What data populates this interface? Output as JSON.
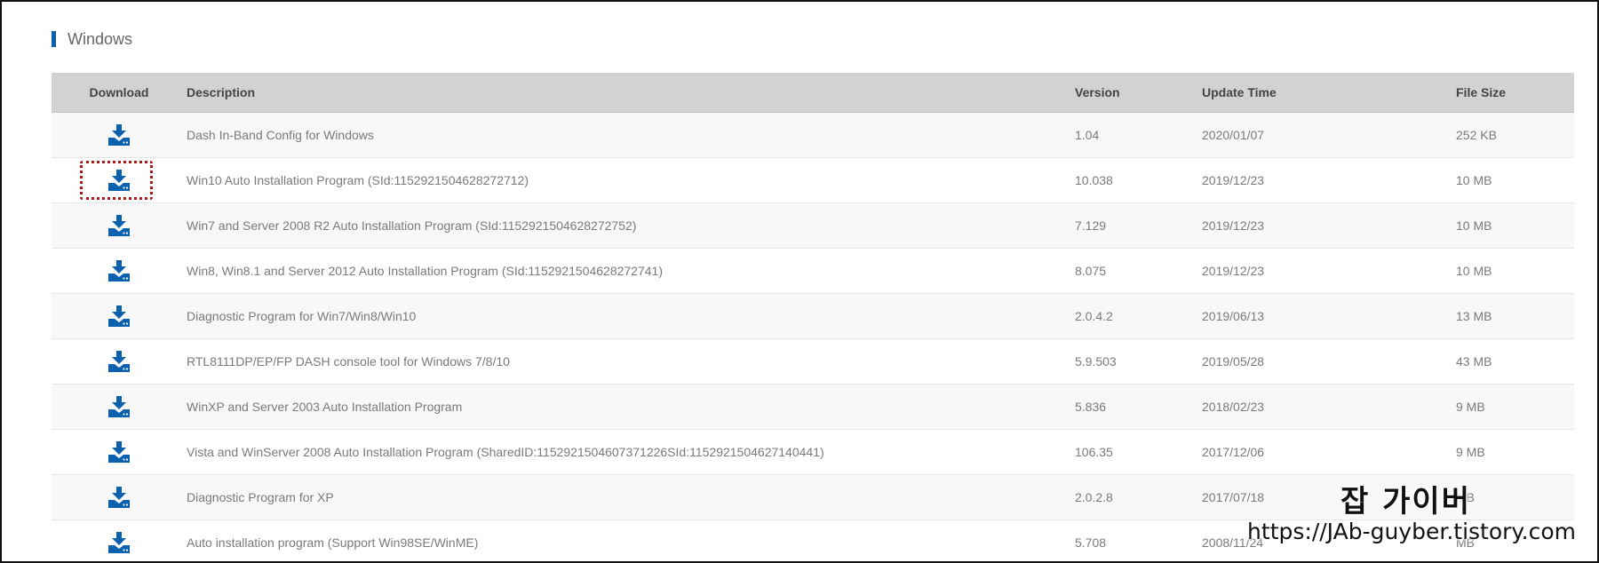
{
  "section": {
    "title": "Windows",
    "accent_color": "#0b61ad"
  },
  "table": {
    "headers": {
      "download": "Download",
      "description": "Description",
      "version": "Version",
      "update_time": "Update Time",
      "file_size": "File Size"
    },
    "download_icon": "download-icon",
    "icon_color": "#0b61ad",
    "rows": [
      {
        "description": "Dash In-Band Config for Windows",
        "version": "1.04",
        "update_time": "2020/01/07",
        "file_size": "252 KB"
      },
      {
        "description": "Win10 Auto Installation Program (SId:1152921504628272712)",
        "version": "10.038",
        "update_time": "2019/12/23",
        "file_size": "10 MB"
      },
      {
        "description": "Win7 and Server 2008 R2 Auto Installation Program (SId:1152921504628272752)",
        "version": "7.129",
        "update_time": "2019/12/23",
        "file_size": "10 MB"
      },
      {
        "description": "Win8, Win8.1 and Server 2012 Auto Installation Program (SId:1152921504628272741)",
        "version": "8.075",
        "update_time": "2019/12/23",
        "file_size": "10 MB"
      },
      {
        "description": "Diagnostic Program for Win7/Win8/Win10",
        "version": "2.0.4.2",
        "update_time": "2019/06/13",
        "file_size": "13 MB"
      },
      {
        "description": "RTL8111DP/EP/FP DASH console tool for Windows 7/8/10",
        "version": "5.9.503",
        "update_time": "2019/05/28",
        "file_size": "43 MB"
      },
      {
        "description": "WinXP and Server 2003 Auto Installation Program",
        "version": "5.836",
        "update_time": "2018/02/23",
        "file_size": "9 MB"
      },
      {
        "description": "Vista and WinServer 2008 Auto Installation Program (SharedID:1152921504607371226SId:1152921504627140441)",
        "version": "106.35",
        "update_time": "2017/12/06",
        "file_size": "9 MB"
      },
      {
        "description": "Diagnostic Program for XP",
        "version": "2.0.2.8",
        "update_time": "2017/07/18",
        "file_size": "MB"
      },
      {
        "description": "Auto installation program (Support Win98SE/WinME)",
        "version": "5.708",
        "update_time": "2008/11/24",
        "file_size": "MB"
      }
    ]
  },
  "highlight": {
    "row_index": 1,
    "color": "#b01818"
  },
  "watermark": {
    "title": "잡 가이버",
    "url": "https://JAb-guyber.tistory.com"
  }
}
